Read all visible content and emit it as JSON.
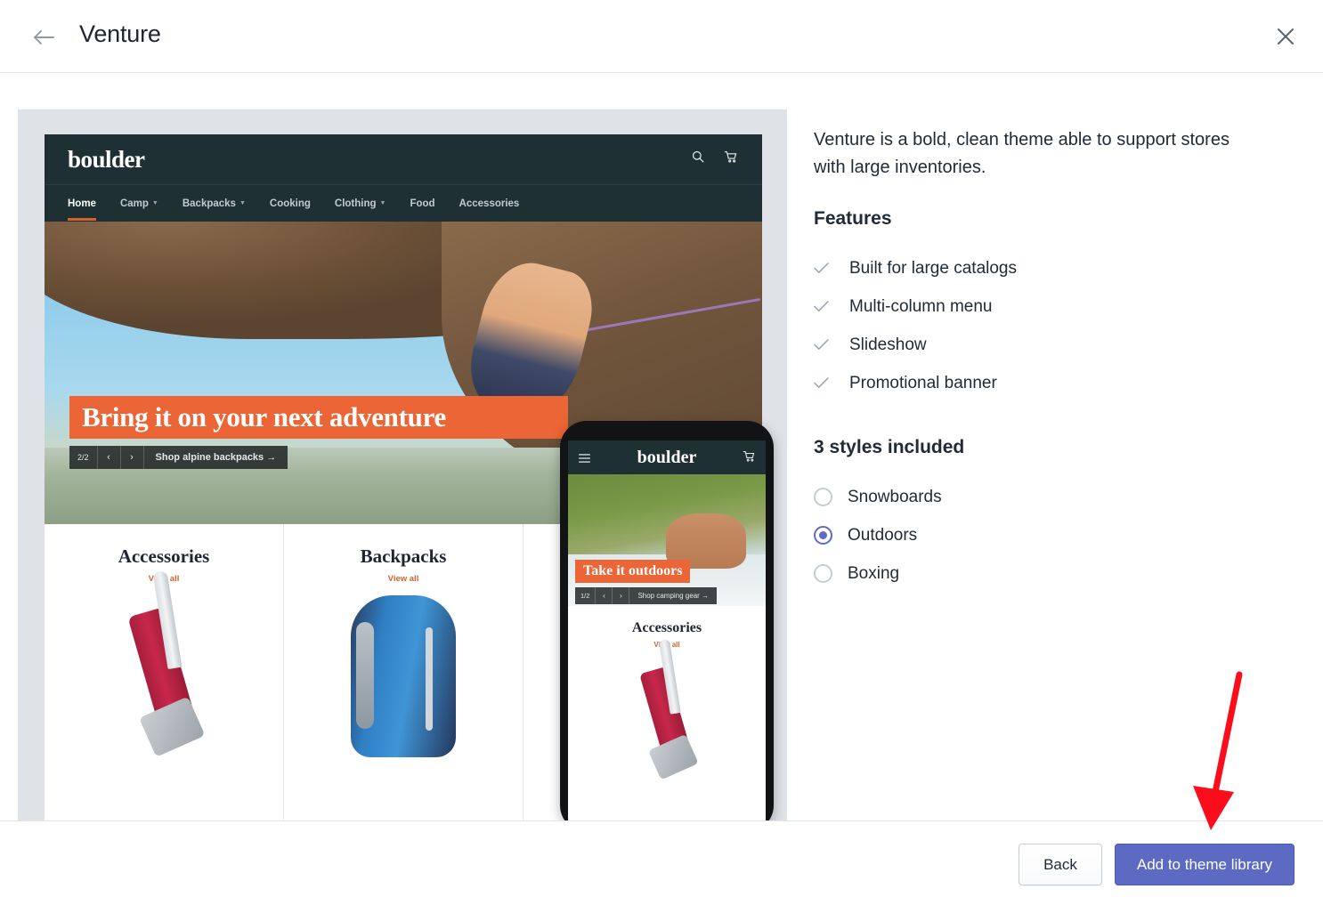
{
  "header": {
    "title": "Venture",
    "back_icon": "arrow-left-icon",
    "close_icon": "close-icon"
  },
  "theme": {
    "description": "Venture is a bold, clean theme able to support stores with large inventories.",
    "features_heading": "Features",
    "features": [
      "Built for large catalogs",
      "Multi-column menu",
      "Slideshow",
      "Promotional banner"
    ],
    "styles_heading": "3 styles included",
    "styles": [
      {
        "label": "Snowboards",
        "selected": false
      },
      {
        "label": "Outdoors",
        "selected": true
      },
      {
        "label": "Boxing",
        "selected": false
      }
    ]
  },
  "preview": {
    "desktop": {
      "logo": "boulder",
      "search_icon": "search-icon",
      "cart_icon": "cart-icon",
      "nav": [
        {
          "label": "Home",
          "active": true,
          "has_dropdown": false
        },
        {
          "label": "Camp",
          "active": false,
          "has_dropdown": true
        },
        {
          "label": "Backpacks",
          "active": false,
          "has_dropdown": true
        },
        {
          "label": "Cooking",
          "active": false,
          "has_dropdown": false
        },
        {
          "label": "Clothing",
          "active": false,
          "has_dropdown": true
        },
        {
          "label": "Food",
          "active": false,
          "has_dropdown": false
        },
        {
          "label": "Accessories",
          "active": false,
          "has_dropdown": false
        }
      ],
      "hero_headline": "Bring it on your next adventure",
      "slide_count": "2/2",
      "prev_icon": "chevron-left-icon",
      "next_icon": "chevron-right-icon",
      "hero_cta": "Shop alpine backpacks →",
      "categories": [
        {
          "title": "Accessories",
          "link": "View all"
        },
        {
          "title": "Backpacks",
          "link": "View all"
        }
      ]
    },
    "mobile": {
      "logo": "boulder",
      "menu_icon": "hamburger-icon",
      "cart_icon": "cart-icon",
      "hero_headline": "Take it outdoors",
      "slide_count": "1/2",
      "prev_icon": "chevron-left-icon",
      "next_icon": "chevron-right-icon",
      "hero_cta": "Shop camping gear →",
      "category_title": "Accessories",
      "category_link": "View all"
    }
  },
  "footer": {
    "back_label": "Back",
    "primary_label": "Add to theme library"
  },
  "colors": {
    "primary": "#5c6ac4",
    "accent_orange": "#ec6536",
    "store_dark": "#1f3034",
    "annotation_red": "#fc0d1b"
  }
}
